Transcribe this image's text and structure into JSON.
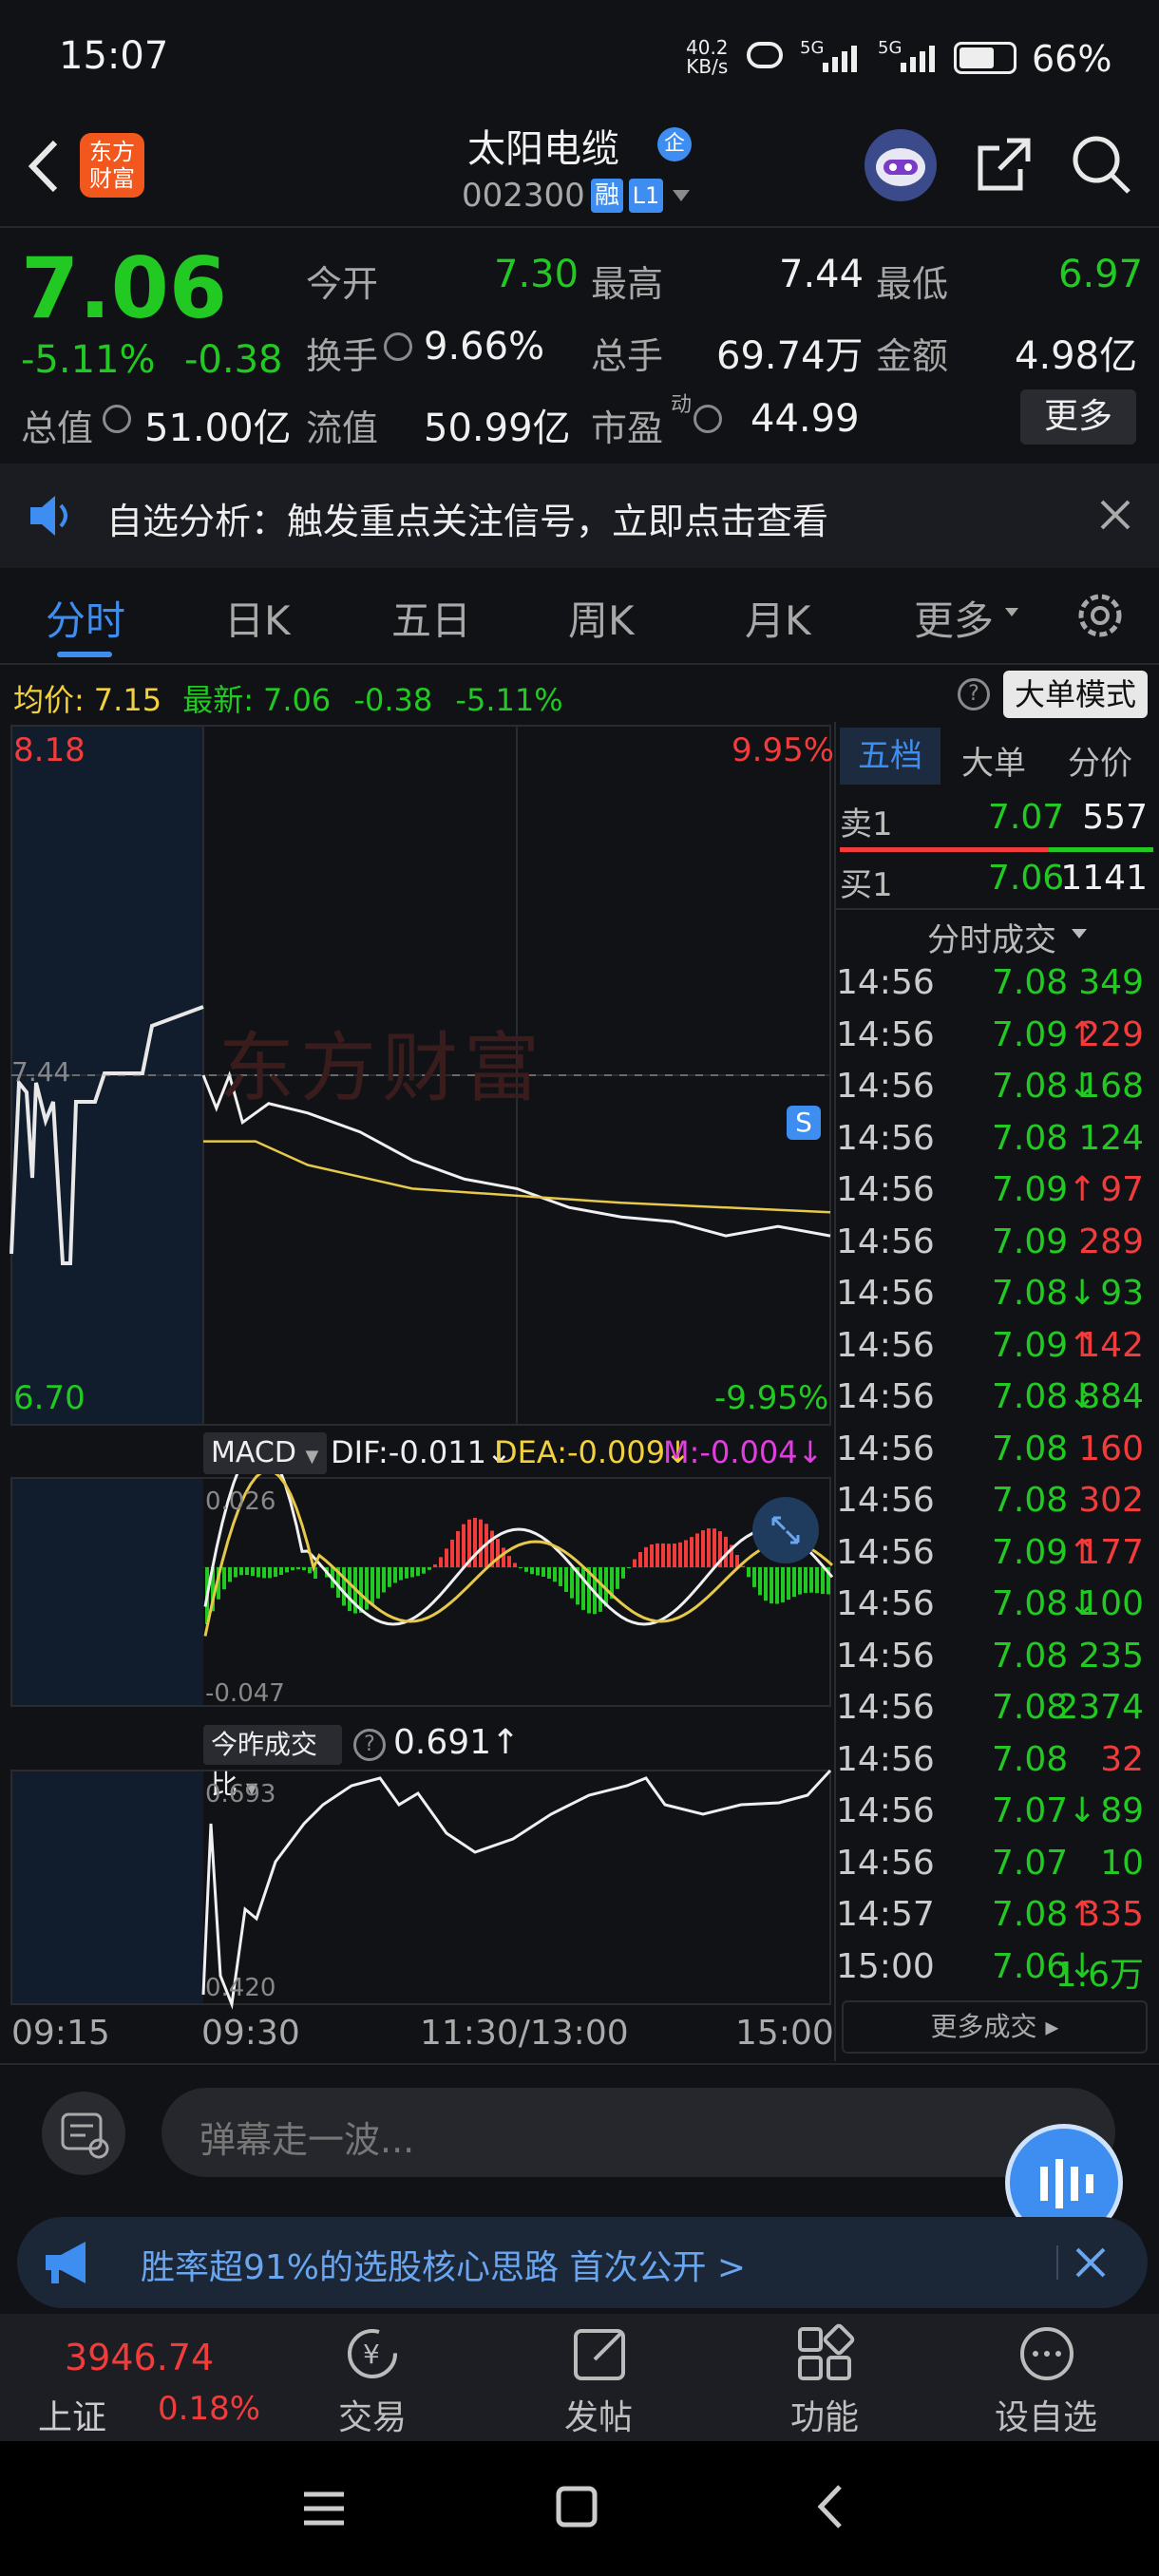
{
  "status": {
    "time": "15:07",
    "net_speed_top": "40.2",
    "net_speed_bottom": "KB/s",
    "signal1": "5G",
    "signal2": "5G",
    "battery": "66%"
  },
  "header": {
    "stock_name": "太阳电缆",
    "stock_code": "002300",
    "badge_rong": "融",
    "badge_level": "L1",
    "logo_text_1": "东方",
    "logo_text_2": "财富",
    "corp_badge": "企"
  },
  "quote": {
    "price": "7.06",
    "change_pct": "-5.11%",
    "change": "-0.38",
    "open_label": "今开",
    "open": "7.30",
    "high_label": "最高",
    "high": "7.44",
    "low_label": "最低",
    "low": "6.97",
    "turnover_label": "换手",
    "turnover": "9.66%",
    "volume_label": "总手",
    "volume": "69.74万",
    "amount_label": "金额",
    "amount": "4.98亿",
    "mcap_label": "总值",
    "mcap": "51.00亿",
    "float_label": "流值",
    "float_mcap": "50.99亿",
    "pe_label": "市盈",
    "pe_sup": "动",
    "pe": "44.99",
    "more_button": "更多"
  },
  "notice": {
    "text": "自选分析：触发重点关注信号，立即点击查看"
  },
  "tabs": [
    "分时",
    "日K",
    "五日",
    "周K",
    "月K",
    "更多"
  ],
  "info_bar": {
    "avg_label": "均价:",
    "avg": "7.15",
    "latest_label": "最新:",
    "latest": "7.06",
    "change": "-0.38",
    "change_pct": "-5.11%",
    "big_order_button": "大单模式"
  },
  "chart": {
    "y_top": "8.18",
    "y_bottom": "6.70",
    "pct_top": "9.95%",
    "pct_bottom": "-9.95%",
    "ref_price": "7.44",
    "watermark": "东方财富",
    "signal_marker": "S",
    "macd_label": "MACD",
    "dif": "DIF:-0.011↓",
    "dea": "DEA:-0.009↓",
    "m": "M:-0.004↓",
    "macd_top": "0.026",
    "macd_bottom": "-0.047",
    "ratio_label": "今昨成交比",
    "ratio": "0.691↑",
    "ratio_top": "0.693",
    "ratio_bottom": "0.420",
    "time_labels": [
      "09:15",
      "09:30",
      "11:30/13:00",
      "15:00"
    ]
  },
  "chart_data": {
    "type": "line",
    "title": "",
    "ylim": [
      6.7,
      8.18
    ],
    "series": [
      {
        "name": "",
        "points": [
          [
            0,
            7.44
          ],
          [
            5,
            7.37
          ],
          [
            10,
            7.44
          ],
          [
            15,
            7.34
          ],
          [
            25,
            7.38
          ],
          [
            40,
            7.36
          ],
          [
            60,
            7.32
          ],
          [
            80,
            7.26
          ],
          [
            100,
            7.22
          ],
          [
            120,
            7.2
          ],
          [
            140,
            7.16
          ],
          [
            160,
            7.14
          ],
          [
            180,
            7.13
          ],
          [
            200,
            7.1
          ],
          [
            220,
            7.12
          ],
          [
            240,
            7.1
          ]
        ]
      },
      {
        "name": "均价",
        "points": [
          [
            0,
            7.3
          ],
          [
            20,
            7.3
          ],
          [
            40,
            7.25
          ],
          [
            80,
            7.2
          ],
          [
            160,
            7.17
          ],
          [
            240,
            7.15
          ]
        ]
      }
    ]
  },
  "book": {
    "tabs": [
      "五档",
      "大单",
      "分价"
    ],
    "sell1_label": "卖1",
    "sell1_price": "7.07",
    "sell1_vol": "557",
    "buy1_label": "买1",
    "buy1_price": "7.06",
    "buy1_vol": "1141",
    "trades_title": "分时成交",
    "trades": [
      {
        "t": "14:56",
        "p": "7.08",
        "a": "",
        "v": "349",
        "c": "green"
      },
      {
        "t": "14:56",
        "p": "7.09",
        "a": "↑",
        "v": "229",
        "c": "red"
      },
      {
        "t": "14:56",
        "p": "7.08",
        "a": "↓",
        "v": "168",
        "c": "green"
      },
      {
        "t": "14:56",
        "p": "7.08",
        "a": "",
        "v": "124",
        "c": "green"
      },
      {
        "t": "14:56",
        "p": "7.09",
        "a": "↑",
        "v": "97",
        "c": "red"
      },
      {
        "t": "14:56",
        "p": "7.09",
        "a": "",
        "v": "289",
        "c": "red"
      },
      {
        "t": "14:56",
        "p": "7.08",
        "a": "↓",
        "v": "93",
        "c": "green"
      },
      {
        "t": "14:56",
        "p": "7.09",
        "a": "↑",
        "v": "142",
        "c": "red"
      },
      {
        "t": "14:56",
        "p": "7.08",
        "a": "↓",
        "v": "884",
        "c": "green"
      },
      {
        "t": "14:56",
        "p": "7.08",
        "a": "",
        "v": "160",
        "c": "red"
      },
      {
        "t": "14:56",
        "p": "7.08",
        "a": "",
        "v": "302",
        "c": "red"
      },
      {
        "t": "14:56",
        "p": "7.09",
        "a": "↑",
        "v": "177",
        "c": "red"
      },
      {
        "t": "14:56",
        "p": "7.08",
        "a": "↓",
        "v": "100",
        "c": "green"
      },
      {
        "t": "14:56",
        "p": "7.08",
        "a": "",
        "v": "235",
        "c": "green"
      },
      {
        "t": "14:56",
        "p": "7.08",
        "a": "",
        "v": "2374",
        "c": "green"
      },
      {
        "t": "14:56",
        "p": "7.08",
        "a": "",
        "v": "32",
        "c": "red"
      },
      {
        "t": "14:56",
        "p": "7.07",
        "a": "↓",
        "v": "89",
        "c": "green"
      },
      {
        "t": "14:56",
        "p": "7.07",
        "a": "",
        "v": "10",
        "c": "green"
      },
      {
        "t": "14:57",
        "p": "7.08",
        "a": "↑",
        "v": "335",
        "c": "red"
      },
      {
        "t": "15:00",
        "p": "7.06",
        "a": "↓",
        "v": "1.6万",
        "c": "green"
      }
    ],
    "more_trades": "更多成交 ▸"
  },
  "comment": {
    "placeholder": "弹幕走一波..."
  },
  "promo": {
    "text": "胜率超91%的选股核心思路 首次公开 >"
  },
  "bottom_nav": {
    "index_value": "3946.74",
    "index_name": "上证",
    "index_pct": "0.18%",
    "trade": "交易",
    "post": "发帖",
    "func": "功能",
    "custom": "设自选"
  },
  "colors": {
    "red": "#f23c3c",
    "green": "#22c922",
    "yellow": "#f2d23c",
    "blue": "#3d8ef0",
    "background": "#111216"
  }
}
